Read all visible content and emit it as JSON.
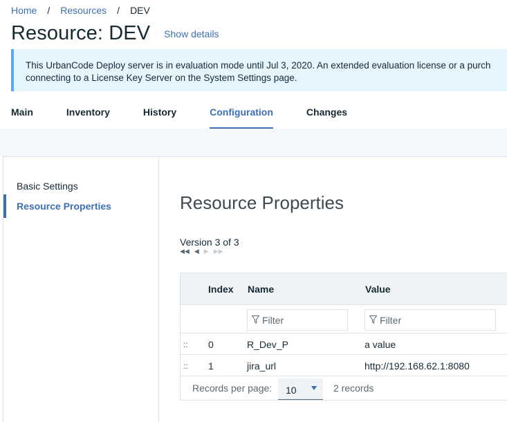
{
  "breadcrumb": {
    "home": "Home",
    "resources": "Resources",
    "separator": "/",
    "current": "DEV"
  },
  "header": {
    "title": "Resource: DEV",
    "show_details": "Show details"
  },
  "banner": {
    "line1": "This UrbanCode Deploy server is in evaluation mode until Jul 3, 2020. An extended evaluation license or a purch",
    "line2": "connecting to a License Key Server on the System Settings page."
  },
  "tabs": [
    {
      "label": "Main"
    },
    {
      "label": "Inventory"
    },
    {
      "label": "History"
    },
    {
      "label": "Configuration",
      "active": true
    },
    {
      "label": "Changes"
    }
  ],
  "sidebar": {
    "items": [
      {
        "label": "Basic Settings"
      },
      {
        "label": "Resource Properties",
        "active": true
      }
    ]
  },
  "main": {
    "section_title": "Resource Properties",
    "version": "Version 3 of 3",
    "table": {
      "columns": {
        "index": "Index",
        "name": "Name",
        "value": "Value"
      },
      "filter_placeholder": "Filter",
      "rows": [
        {
          "drag": "::",
          "index": "0",
          "name": "R_Dev_P",
          "value": "a value"
        },
        {
          "drag": "::",
          "index": "1",
          "name": "jira_url",
          "value": "http://192.168.62.1:8080"
        }
      ],
      "footer": {
        "records_per_page_label": "Records per page:",
        "records_per_page": "10",
        "records_count": "2 records"
      }
    }
  },
  "colors": {
    "accent": "#3d70b2",
    "banner_bg": "#e5f6ff",
    "banner_border": "#5aaafa"
  }
}
